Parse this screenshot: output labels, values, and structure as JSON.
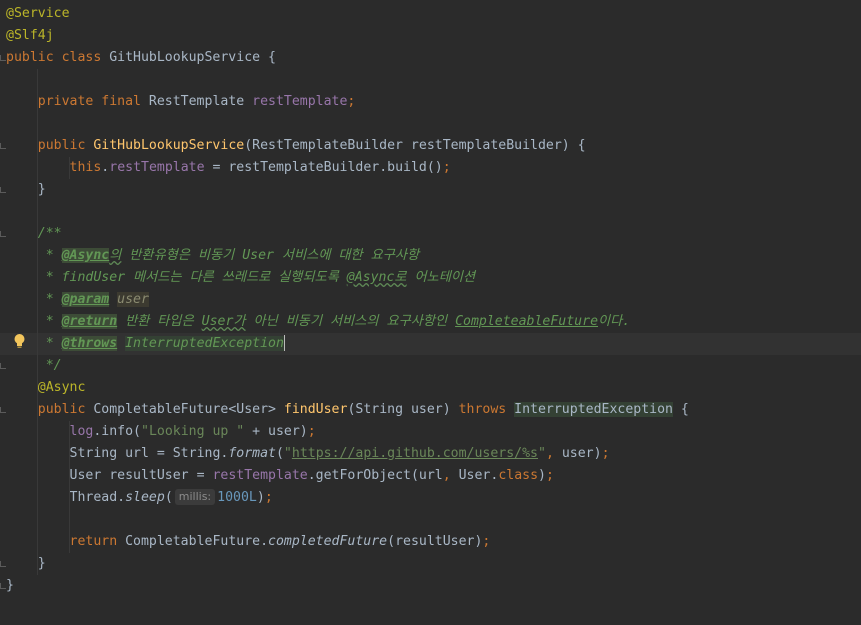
{
  "editor": {
    "lines": [
      {
        "segments": [
          {
            "t": "@Service",
            "c": "ann"
          }
        ]
      },
      {
        "segments": [
          {
            "t": "@Slf4j",
            "c": "ann"
          }
        ]
      },
      {
        "segments": [
          {
            "t": "public class ",
            "c": "kw"
          },
          {
            "t": "GitHubLookupService {",
            "c": "cls"
          }
        ]
      },
      {
        "segments": []
      },
      {
        "segments": [
          {
            "t": "    "
          },
          {
            "t": "private final ",
            "c": "kw"
          },
          {
            "t": "RestTemplate ",
            "c": "cls"
          },
          {
            "t": "restTemplate",
            "c": "fld"
          },
          {
            "t": ";",
            "c": "kw"
          }
        ]
      },
      {
        "segments": []
      },
      {
        "segments": [
          {
            "t": "    "
          },
          {
            "t": "public ",
            "c": "kw"
          },
          {
            "t": "GitHubLookupService",
            "c": "mth"
          },
          {
            "t": "(RestTemplateBuilder restTemplateBuilder) {",
            "c": "cls"
          }
        ]
      },
      {
        "segments": [
          {
            "t": "        "
          },
          {
            "t": "this",
            "c": "kw"
          },
          {
            "t": ".",
            "c": "cls"
          },
          {
            "t": "restTemplate",
            "c": "fld"
          },
          {
            "t": " = restTemplateBuilder.build()",
            "c": "cls"
          },
          {
            "t": ";",
            "c": "kw"
          }
        ]
      },
      {
        "segments": [
          {
            "t": "    }",
            "c": "cls"
          }
        ]
      },
      {
        "segments": []
      },
      {
        "segments": [
          {
            "t": "    /**",
            "c": "doc"
          }
        ]
      },
      {
        "segments": [
          {
            "t": "     * ",
            "c": "doc"
          },
          {
            "t": "@Async",
            "c": "dtag"
          },
          {
            "t": "의",
            "c": "doc wavy"
          },
          {
            "t": " 반환유형은 비동기 User 서비스에 대한 요구사항",
            "c": "doc"
          }
        ]
      },
      {
        "segments": [
          {
            "t": "     * findUser 메서드는 다른 쓰레드로 실행되도록 ",
            "c": "doc"
          },
          {
            "t": "@Async로",
            "c": "doc wavy"
          },
          {
            "t": " 어노테이션",
            "c": "doc"
          }
        ]
      },
      {
        "segments": [
          {
            "t": "     * ",
            "c": "doc"
          },
          {
            "t": "@param",
            "c": "dtag"
          },
          {
            "t": " ",
            "c": "doc"
          },
          {
            "t": "user",
            "c": "dref"
          }
        ]
      },
      {
        "segments": [
          {
            "t": "     * ",
            "c": "doc"
          },
          {
            "t": "@return",
            "c": "dtag"
          },
          {
            "t": " 반환 타입은 ",
            "c": "doc"
          },
          {
            "t": "User가",
            "c": "doc wavy"
          },
          {
            "t": " 아닌 비동기 서비스의 요구사항인 ",
            "c": "doc"
          },
          {
            "t": "CompleteableFuture",
            "c": "dlink"
          },
          {
            "t": "이다.",
            "c": "doc"
          }
        ]
      },
      {
        "segments": [
          {
            "t": "     * ",
            "c": "doc"
          },
          {
            "t": "@throws",
            "c": "dtag"
          },
          {
            "t": " ",
            "c": "doc"
          },
          {
            "t": "InterruptedException",
            "c": "doc exc"
          },
          {
            "t": "",
            "c": "caret"
          }
        ]
      },
      {
        "segments": [
          {
            "t": "     */",
            "c": "doc"
          }
        ]
      },
      {
        "segments": [
          {
            "t": "    "
          },
          {
            "t": "@Async",
            "c": "ann"
          }
        ]
      },
      {
        "segments": [
          {
            "t": "    "
          },
          {
            "t": "public ",
            "c": "kw"
          },
          {
            "t": "CompletableFuture<User> ",
            "c": "cls"
          },
          {
            "t": "findUser",
            "c": "mth"
          },
          {
            "t": "(String user) ",
            "c": "cls"
          },
          {
            "t": "throws ",
            "c": "kw"
          },
          {
            "t": "InterruptedException",
            "c": "cls exc"
          },
          {
            "t": " {",
            "c": "cls"
          }
        ]
      },
      {
        "segments": [
          {
            "t": "        "
          },
          {
            "t": "log",
            "c": "fld"
          },
          {
            "t": ".info(",
            "c": "cls"
          },
          {
            "t": "\"Looking up \"",
            "c": "str"
          },
          {
            "t": " + user)",
            "c": "cls"
          },
          {
            "t": ";",
            "c": "kw"
          }
        ]
      },
      {
        "segments": [
          {
            "t": "        "
          },
          {
            "t": "String url = String.",
            "c": "cls"
          },
          {
            "t": "format",
            "c": "statc"
          },
          {
            "t": "(",
            "c": "cls"
          },
          {
            "t": "\"",
            "c": "str"
          },
          {
            "t": "https://api.github.com/users/%s",
            "c": "url"
          },
          {
            "t": "\"",
            "c": "str"
          },
          {
            "t": ", ",
            "c": "kw"
          },
          {
            "t": "user)",
            "c": "cls"
          },
          {
            "t": ";",
            "c": "kw"
          }
        ]
      },
      {
        "segments": [
          {
            "t": "        "
          },
          {
            "t": "User resultUser = ",
            "c": "cls"
          },
          {
            "t": "restTemplate",
            "c": "fld"
          },
          {
            "t": ".getForObject(url",
            "c": "cls"
          },
          {
            "t": ", ",
            "c": "kw"
          },
          {
            "t": "User.",
            "c": "cls"
          },
          {
            "t": "class",
            "c": "kw"
          },
          {
            "t": ")",
            "c": "cls"
          },
          {
            "t": ";",
            "c": "kw"
          }
        ]
      },
      {
        "segments": [
          {
            "t": "        "
          },
          {
            "t": "Thread.",
            "c": "cls"
          },
          {
            "t": "sleep",
            "c": "statc"
          },
          {
            "t": "(",
            "c": "cls"
          },
          {
            "t": "millis:",
            "c": "hint"
          },
          {
            "t": "1000L",
            "c": "num"
          },
          {
            "t": ")",
            "c": "cls"
          },
          {
            "t": ";",
            "c": "kw"
          }
        ]
      },
      {
        "segments": []
      },
      {
        "segments": [
          {
            "t": "        "
          },
          {
            "t": "return ",
            "c": "kw"
          },
          {
            "t": "CompletableFuture.",
            "c": "cls"
          },
          {
            "t": "completedFuture",
            "c": "statc"
          },
          {
            "t": "(resultUser)",
            "c": "cls"
          },
          {
            "t": ";",
            "c": "kw"
          }
        ]
      },
      {
        "segments": [
          {
            "t": "    }",
            "c": "cls"
          }
        ]
      },
      {
        "segments": [
          {
            "t": "}",
            "c": "cls"
          }
        ]
      }
    ],
    "current_line": 15,
    "icons": [
      "intention-bulb-icon",
      "fold-marker-icon"
    ]
  }
}
